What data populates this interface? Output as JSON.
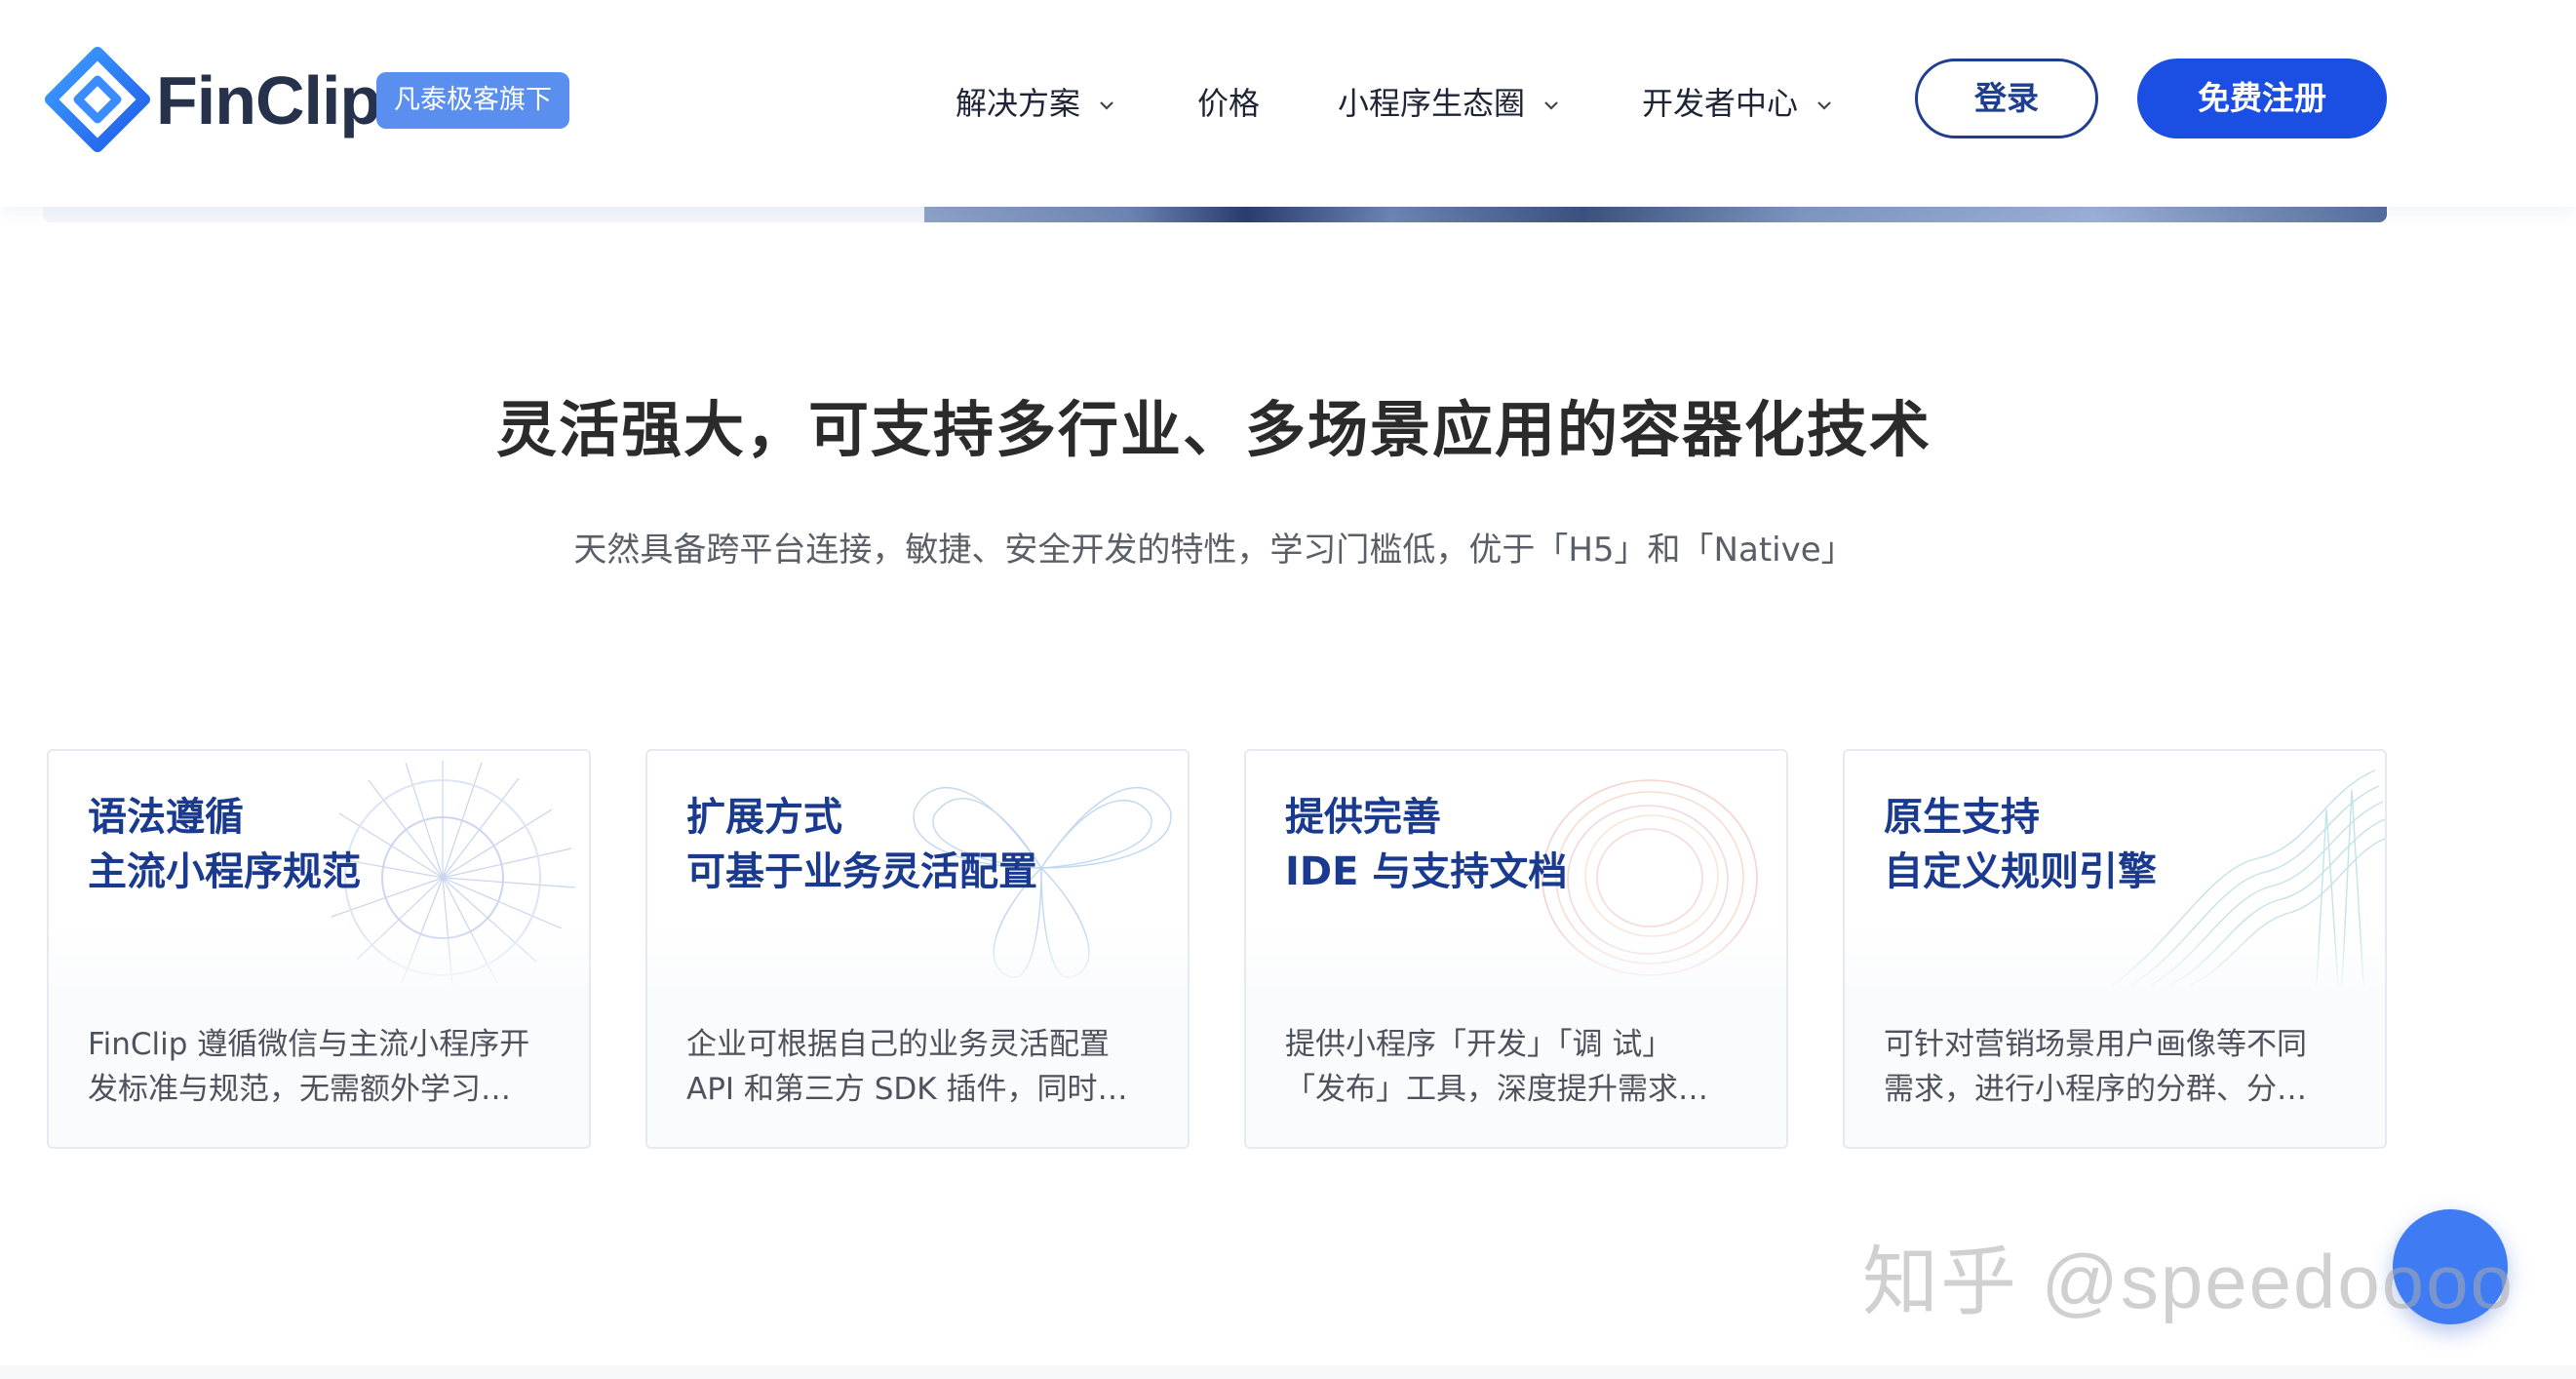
{
  "header": {
    "brand_name": "FinClip",
    "brand_tag": "凡泰极客旗下",
    "nav": [
      {
        "label": "解决方案",
        "has_dropdown": true
      },
      {
        "label": "价格",
        "has_dropdown": false
      },
      {
        "label": "小程序生态圈",
        "has_dropdown": true
      },
      {
        "label": "开发者中心",
        "has_dropdown": true
      }
    ],
    "login_label": "登录",
    "signup_label": "免费注册"
  },
  "section": {
    "title": "灵活强大，可支持多行业、多场景应用的容器化技术",
    "subtitle": "天然具备跨平台连接，敏捷、安全开发的特性，学习门槛低，优于「H5」和「Native」"
  },
  "cards": [
    {
      "title_line1": "语法遵循",
      "title_line2": "主流小程序规范",
      "desc_line1": "FinClip 遵循微信与主流小程序开",
      "desc_line2": "发标准与规范，无需额外学习…"
    },
    {
      "title_line1": "扩展方式",
      "title_line2": "可基于业务灵活配置",
      "desc_line1": "企业可根据自己的业务灵活配置",
      "desc_line2": "API 和第三方 SDK 插件，同时…"
    },
    {
      "title_line1": "提供完善",
      "title_line2": "IDE 与支持文档",
      "desc_line1": "提供小程序「开发」「调 试」",
      "desc_line2": "「发布」工具，深度提升需求…"
    },
    {
      "title_line1": "原生支持",
      "title_line2": "自定义规则引擎",
      "desc_line1": "可针对营销场景用户画像等不同",
      "desc_line2": "需求，进行小程序的分群、分…"
    }
  ],
  "watermark": "知乎 @speedoooo",
  "colors": {
    "primary": "#1b4fe3",
    "card_title": "#1a3a8f",
    "brand_tag_bg": "#5a8ff0",
    "float_button": "#3f7cf3"
  }
}
